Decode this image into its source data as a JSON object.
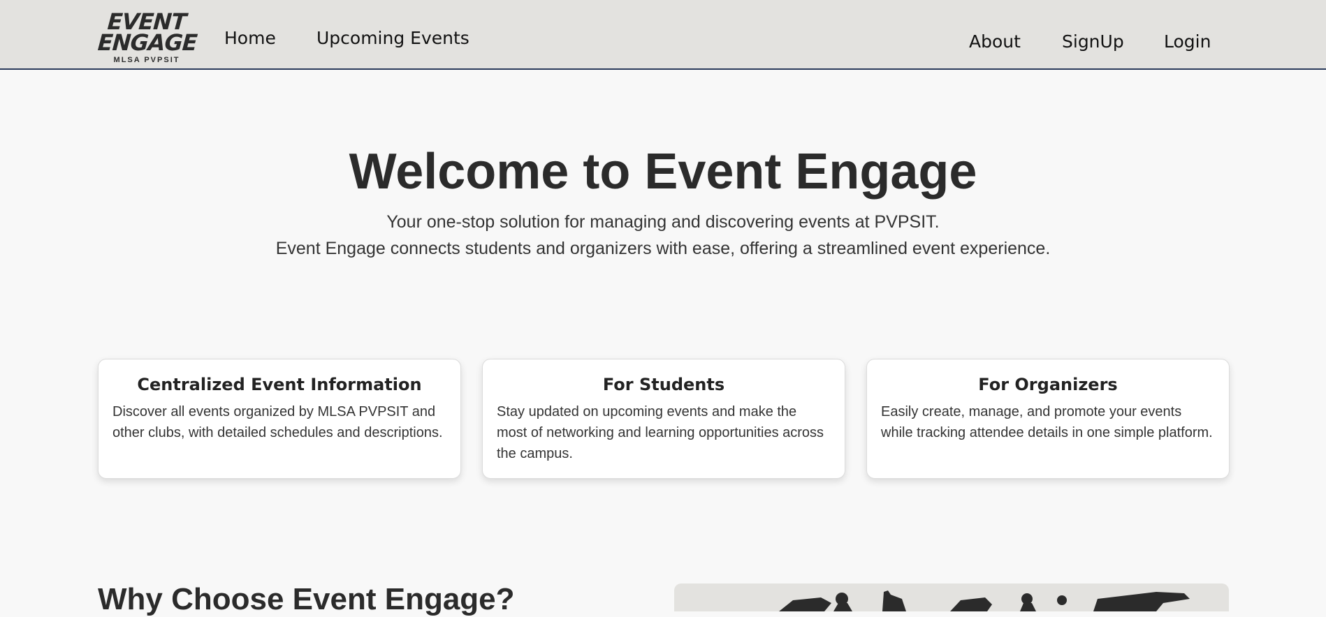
{
  "nav": {
    "logo": {
      "line1": "EVENT",
      "line2": "ENGAGE",
      "line3": "MLSA PVPSIT"
    },
    "left_links": [
      "Home",
      "Upcoming Events"
    ],
    "right_links": [
      "About",
      "SignUp",
      "Login"
    ]
  },
  "hero": {
    "title": "Welcome to Event Engage",
    "subtitle1": "Your one-stop solution for managing and discovering events at PVPSIT.",
    "subtitle2": "Event Engage connects students and organizers with ease, offering a streamlined event experience."
  },
  "cards": [
    {
      "title": "Centralized Event Information",
      "text": "Discover all events organized by MLSA PVPSIT and other clubs, with detailed schedules and descriptions."
    },
    {
      "title": "For Students",
      "text": "Stay updated on upcoming events and make the most of networking and learning opportunities across the campus."
    },
    {
      "title": "For Organizers",
      "text": "Easily create, manage, and promote your events while tracking attendee details in one simple platform."
    }
  ],
  "why": {
    "title": "Why Choose Event Engage?"
  },
  "colors": {
    "navbar_bg": "#e3e2df",
    "navbar_border": "#2a3a5a",
    "page_bg": "#f8f8f8",
    "text": "#2b2b2b"
  }
}
